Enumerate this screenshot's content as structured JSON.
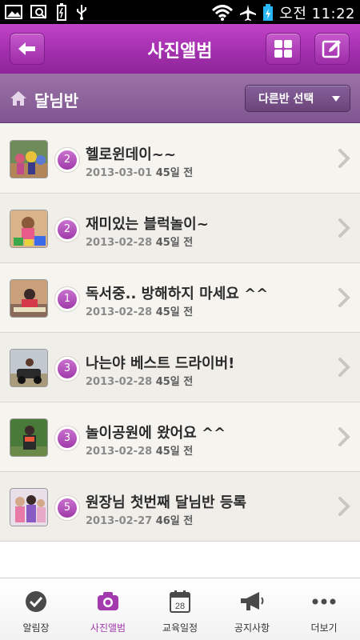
{
  "status_bar": {
    "time": "오전 11:22",
    "battery_icon": "battery-charging-icon",
    "wifi_icon": "wifi-icon",
    "airplane_icon": "airplane-icon"
  },
  "header": {
    "title": "사진앨범",
    "back_icon": "back-arrow-icon",
    "grid_icon": "grid-view-icon",
    "write_icon": "compose-icon"
  },
  "class_bar": {
    "name": "달님반",
    "select_label": "다른반 선택"
  },
  "albums": [
    {
      "count": "2",
      "title": "헬로윈데이~~",
      "date": "2013-03-01",
      "ago": "45일 전"
    },
    {
      "count": "2",
      "title": "재미있는 블럭놀이~",
      "date": "2013-02-28",
      "ago": "45일 전"
    },
    {
      "count": "1",
      "title": "독서중.. 방해하지 마세요 ^^",
      "date": "2013-02-28",
      "ago": "45일 전"
    },
    {
      "count": "3",
      "title": "나는야 베스트 드라이버!",
      "date": "2013-02-28",
      "ago": "45일 전"
    },
    {
      "count": "3",
      "title": "놀이공원에 왔어요 ^^",
      "date": "2013-02-28",
      "ago": "45일 전"
    },
    {
      "count": "5",
      "title": "원장님 첫번째 달님반 등록",
      "date": "2013-02-27",
      "ago": "46일 전"
    }
  ],
  "bottom_nav": [
    {
      "label": "알림장",
      "icon": "check-circle-icon",
      "active": false
    },
    {
      "label": "사진앨범",
      "icon": "camera-icon",
      "active": true
    },
    {
      "label": "교육일정",
      "icon": "calendar-icon",
      "active": false
    },
    {
      "label": "공지사항",
      "icon": "megaphone-icon",
      "active": false
    },
    {
      "label": "더보기",
      "icon": "more-dots-icon",
      "active": false
    }
  ],
  "colors": {
    "accent": "#a33aad",
    "header_purple": "#a32fae",
    "class_bar": "#8a62a0"
  }
}
